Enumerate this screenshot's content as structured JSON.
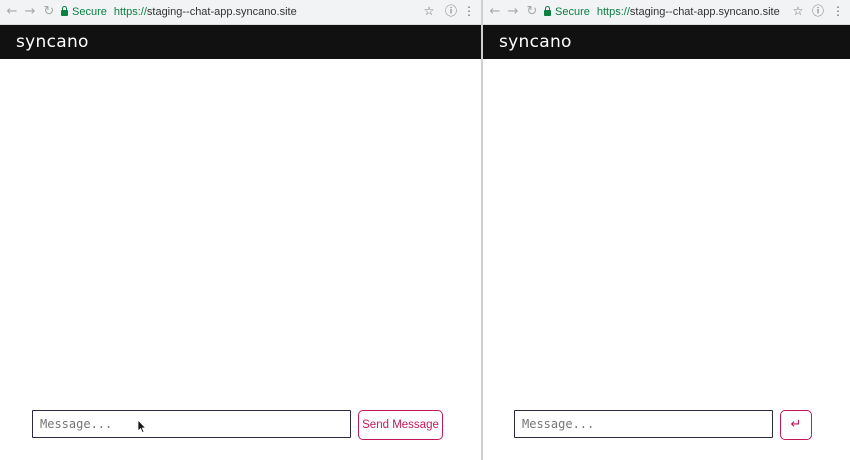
{
  "windows": [
    {
      "browser": {
        "secure_label": "Secure",
        "url_scheme": "https://",
        "url_host": "staging--chat-app.syncano.site"
      },
      "logo": "syncano",
      "message_placeholder": "Message...",
      "send_label": "Send Message"
    },
    {
      "browser": {
        "secure_label": "Secure",
        "url_scheme": "https://",
        "url_host": "staging--chat-app.syncano.site"
      },
      "logo": "syncano",
      "message_placeholder": "Message...",
      "send_icon": "enter-return-icon"
    }
  ],
  "colors": {
    "accent": "#c2185b",
    "header_bg": "#111111",
    "secure_green": "#0b8043"
  }
}
